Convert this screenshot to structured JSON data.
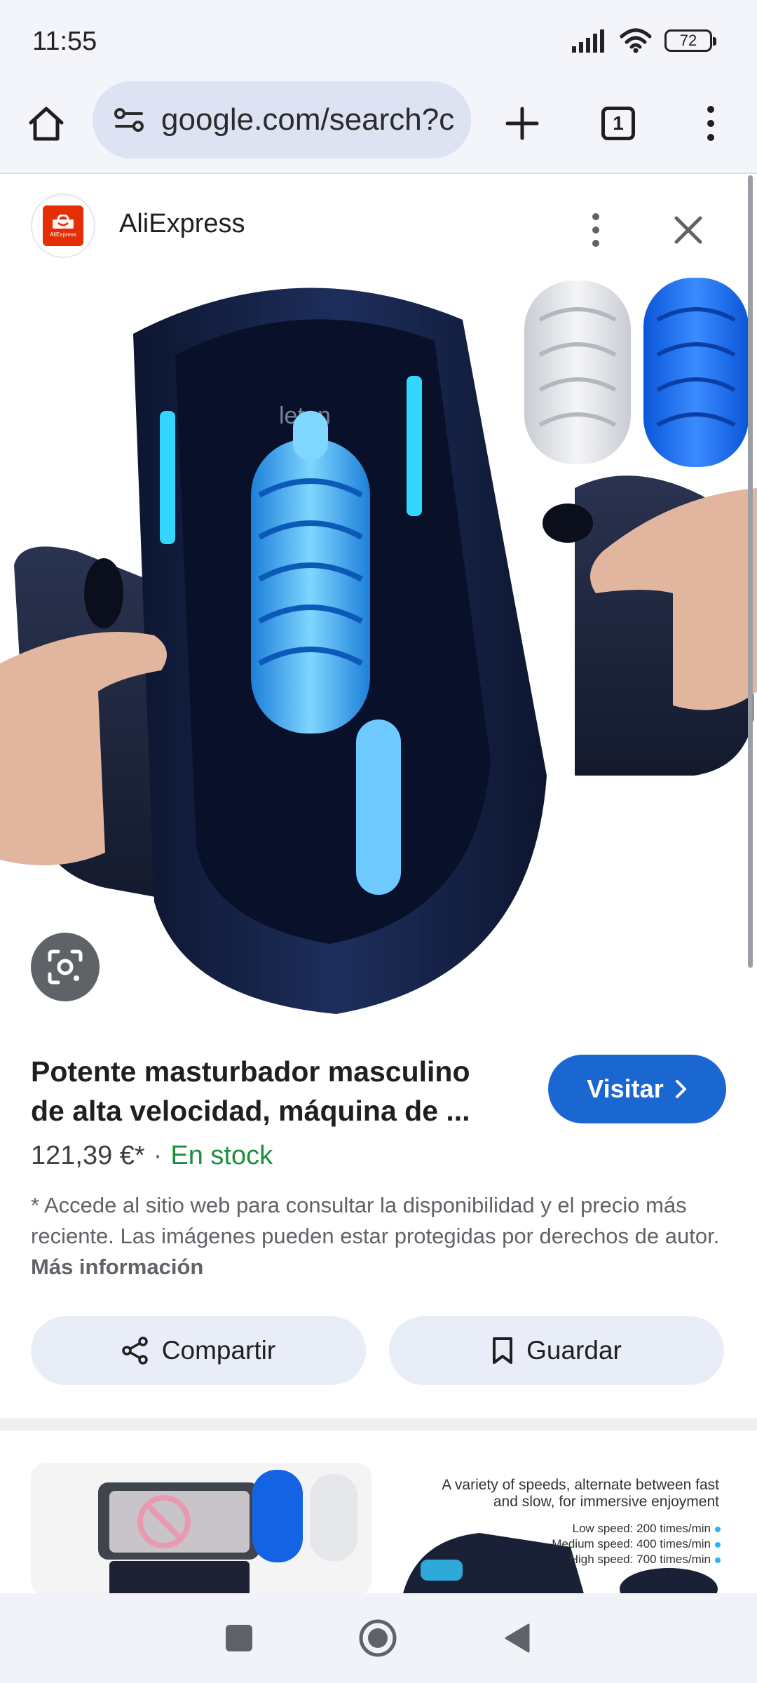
{
  "status_bar": {
    "time": "11:55",
    "battery": "72"
  },
  "browser": {
    "url": "google.com/search?c",
    "tab_count": "1"
  },
  "result": {
    "site_name": "AliExpress",
    "logo_text": "AliExpress",
    "title": "Potente masturbador masculino de alta velocidad, máquina de ...",
    "visit_label": "Visitar",
    "price": "121,39 €*",
    "separator": "·",
    "stock": "En stock",
    "disclaimer": "* Accede al sitio web para consultar la disponibilidad y el precio más reciente. Las imágenes pueden estar protegidas por derechos de autor.",
    "more_info": "Más información",
    "share_label": "Compartir",
    "save_label": "Guardar",
    "brand_mark": "leten"
  },
  "related": {
    "card2_title_1": "A variety of speeds, alternate between fast",
    "card2_title_2": "and slow, for immersive enjoyment",
    "card2_low": "Low speed: 200 times/min",
    "card2_medium": "Medium speed: 400 times/min",
    "card2_high": "High speed: 700 times/min"
  },
  "colors": {
    "accent": "#1a67d2",
    "stock_green": "#1e8e3e",
    "button_bg": "#e8edf8",
    "toolbar_bg": "#f3f5fb"
  }
}
